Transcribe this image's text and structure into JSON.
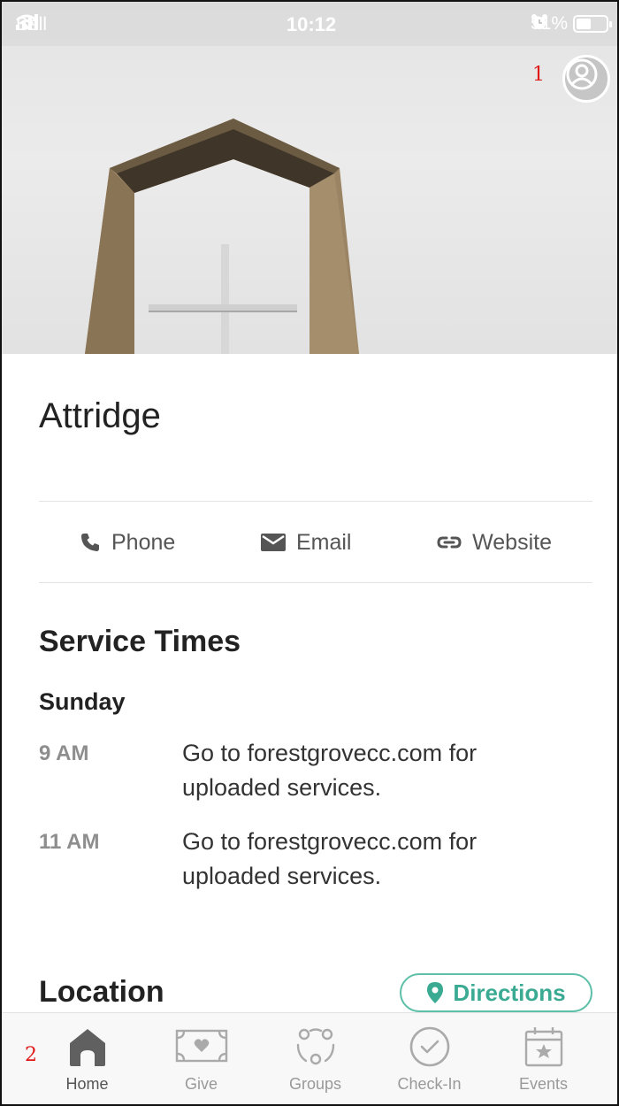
{
  "status_bar": {
    "carrier": "Bell",
    "time": "10:12",
    "battery": "51%",
    "battery_level": 0.51
  },
  "annotations": [
    "1",
    "2"
  ],
  "church": {
    "name": "Attridge"
  },
  "contact": [
    {
      "icon": "phone-icon",
      "label": "Phone"
    },
    {
      "icon": "mail-icon",
      "label": "Email"
    },
    {
      "icon": "link-icon",
      "label": "Website"
    }
  ],
  "service_times": {
    "heading": "Service Times",
    "day": "Sunday",
    "items": [
      {
        "time": "9 AM",
        "description": "Go to forestgrovecc.com for uploaded services."
      },
      {
        "time": "11 AM",
        "description": "Go to forestgrovecc.com for uploaded services."
      }
    ]
  },
  "location": {
    "heading": "Location",
    "directions_label": "Directions"
  },
  "tabs": [
    {
      "icon": "home-icon",
      "label": "Home",
      "active": true
    },
    {
      "icon": "give-icon",
      "label": "Give",
      "active": false
    },
    {
      "icon": "groups-icon",
      "label": "Groups",
      "active": false
    },
    {
      "icon": "check-in-icon",
      "label": "Check-In",
      "active": false
    },
    {
      "icon": "events-icon",
      "label": "Events",
      "active": false
    }
  ],
  "colors": {
    "accent": "#3aaa92",
    "annotation": "#e01818",
    "tab_active": "#555555",
    "tab_inactive": "#999999"
  }
}
